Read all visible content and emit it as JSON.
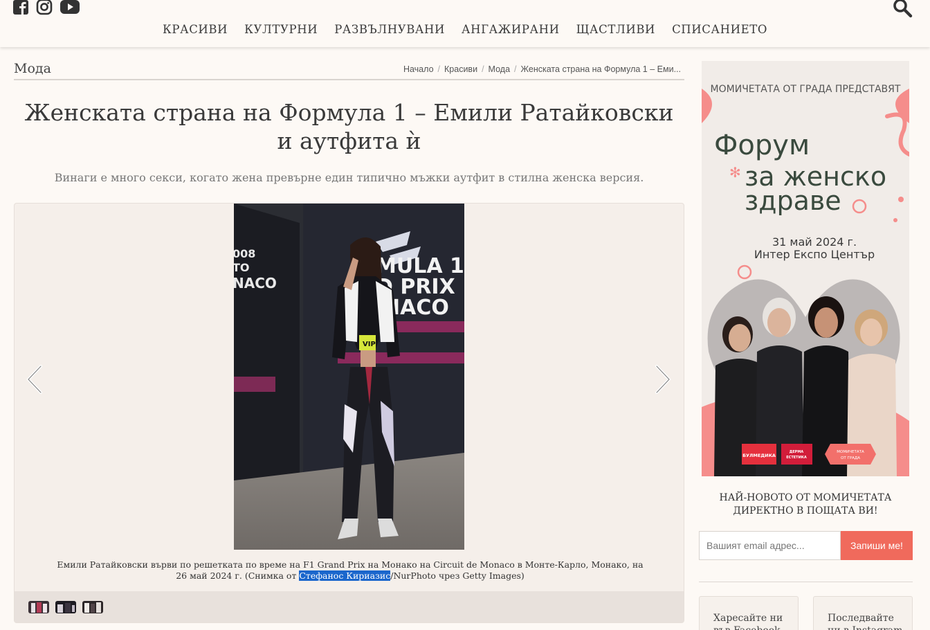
{
  "header": {
    "social": [
      "facebook-icon",
      "instagram-icon",
      "youtube-icon"
    ],
    "nav": [
      "КРАСИВИ",
      "КУЛТУРНИ",
      "РАЗВЪЛНУВАНИ",
      "АНГАЖИРАНИ",
      "ЩАСТЛИВИ",
      "СПИСАНИЕТО"
    ]
  },
  "section": {
    "title": "Мода"
  },
  "breadcrumb": [
    "Начало",
    "Красиви",
    "Мода",
    "Женската страна на Формула 1 – Еми..."
  ],
  "article": {
    "title": "Женската страна на Формула 1 – Емили Ратайковски и аутфита ѝ",
    "lead": "Винаги е много секси, когато жена превърне един типично мъжки аутфит в стилна женска версия.",
    "caption_before": "Емили Ратайковски върви по решетката по време на F1 Grand Prix на Монако на Circuit de Monaco в Монте-Карло, Монако, на 26 май 2024 г. (Снимка от ",
    "caption_highlight": "Стефанос Кириазис",
    "caption_after": "/NurPhoto чрез Getty Images)"
  },
  "photo": {
    "wall_text_right": [
      "MULA 1",
      "D PRIX",
      "NACO"
    ],
    "wall_text_left": [
      "008",
      "TO",
      "NACO"
    ],
    "badge": "VIP"
  },
  "ad": {
    "kicker": "МОМИЧЕТАТА ОТ ГРАДА ПРЕДСТАВЯТ",
    "line1": "Форум",
    "line2": "за женско",
    "line3": "здраве",
    "date": "31 май 2024 г.",
    "venue": "Интер Експо Център",
    "logos": [
      "БУЛМЕДИКА",
      "ДЕРМА ЕСТЕТИКА",
      "МОМИЧЕТАТА ОТ ГРАДА"
    ]
  },
  "newsletter": {
    "title": "НАЙ-НОВОТО ОТ МОМИЧЕТАТА ДИРЕКТНО В ПОЩАТА ВИ!",
    "placeholder": "Вашият email адрес...",
    "button": "Запиши ме!"
  },
  "follow": {
    "facebook": "Харесайте ни във Facebook",
    "instagram": "Последвайте ни в Instagram"
  },
  "colors": {
    "accent": "#f06a5c",
    "background": "#fdf9f5",
    "highlight": "#1a66cc"
  }
}
